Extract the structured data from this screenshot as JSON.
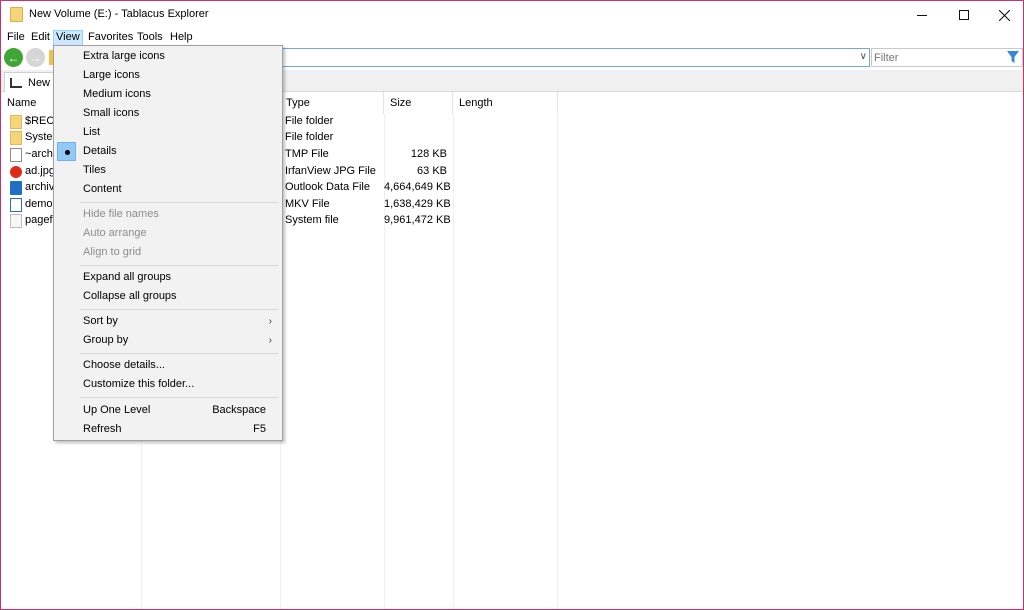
{
  "window": {
    "title": "New Volume (E:) - Tablacus Explorer",
    "border_color": "#c8336b"
  },
  "menubar": {
    "file": "File",
    "edit": "Edit",
    "view": "View",
    "favorites": "Favorites",
    "tools": "Tools",
    "help": "Help"
  },
  "toolbar": {
    "back_icon": "back-arrow-icon",
    "forward_icon": "forward-arrow-icon",
    "address_value": "",
    "filter_placeholder": "Filter"
  },
  "tabs": [
    {
      "label": "New"
    }
  ],
  "columns": {
    "name": "Name",
    "type": "Type",
    "size": "Size",
    "length": "Length"
  },
  "files": [
    {
      "name": "$RECY",
      "type": "File folder",
      "size": "",
      "icon": "folder-icon"
    },
    {
      "name": "Syster",
      "type": "File folder",
      "size": "",
      "icon": "folder-icon"
    },
    {
      "name": "~arch",
      "type": "TMP File",
      "size": "128 KB",
      "icon": "file-icon"
    },
    {
      "name": "ad.jpg",
      "type": "IrfanView JPG File",
      "size": "63 KB",
      "icon": "irfanview-icon"
    },
    {
      "name": "archiv",
      "type": "Outlook Data File",
      "size": "4,664,649 KB",
      "icon": "outlook-icon"
    },
    {
      "name": "demo",
      "type": "MKV File",
      "size": "1,638,429 KB",
      "icon": "video-file-icon"
    },
    {
      "name": "pagef",
      "type": "System file",
      "size": "9,961,472 KB",
      "icon": "system-file-icon"
    }
  ],
  "view_menu": {
    "extra_large_icons": "Extra large icons",
    "large_icons": "Large icons",
    "medium_icons": "Medium icons",
    "small_icons": "Small icons",
    "list": "List",
    "details": "Details",
    "tiles": "Tiles",
    "content": "Content",
    "hide_file_names": "Hide file names",
    "auto_arrange": "Auto arrange",
    "align_to_grid": "Align to grid",
    "expand_all_groups": "Expand all groups",
    "collapse_all_groups": "Collapse all groups",
    "sort_by": "Sort by",
    "group_by": "Group by",
    "choose_details": "Choose details...",
    "customize_folder": "Customize this folder...",
    "up_one_level": "Up One Level",
    "up_one_level_shortcut": "Backspace",
    "refresh": "Refresh",
    "refresh_shortcut": "F5",
    "selected_view": "Details"
  },
  "colors": {
    "accent_highlight": "#cce8ff",
    "check_bg": "#91c9f7",
    "back_button": "#3fa534"
  }
}
